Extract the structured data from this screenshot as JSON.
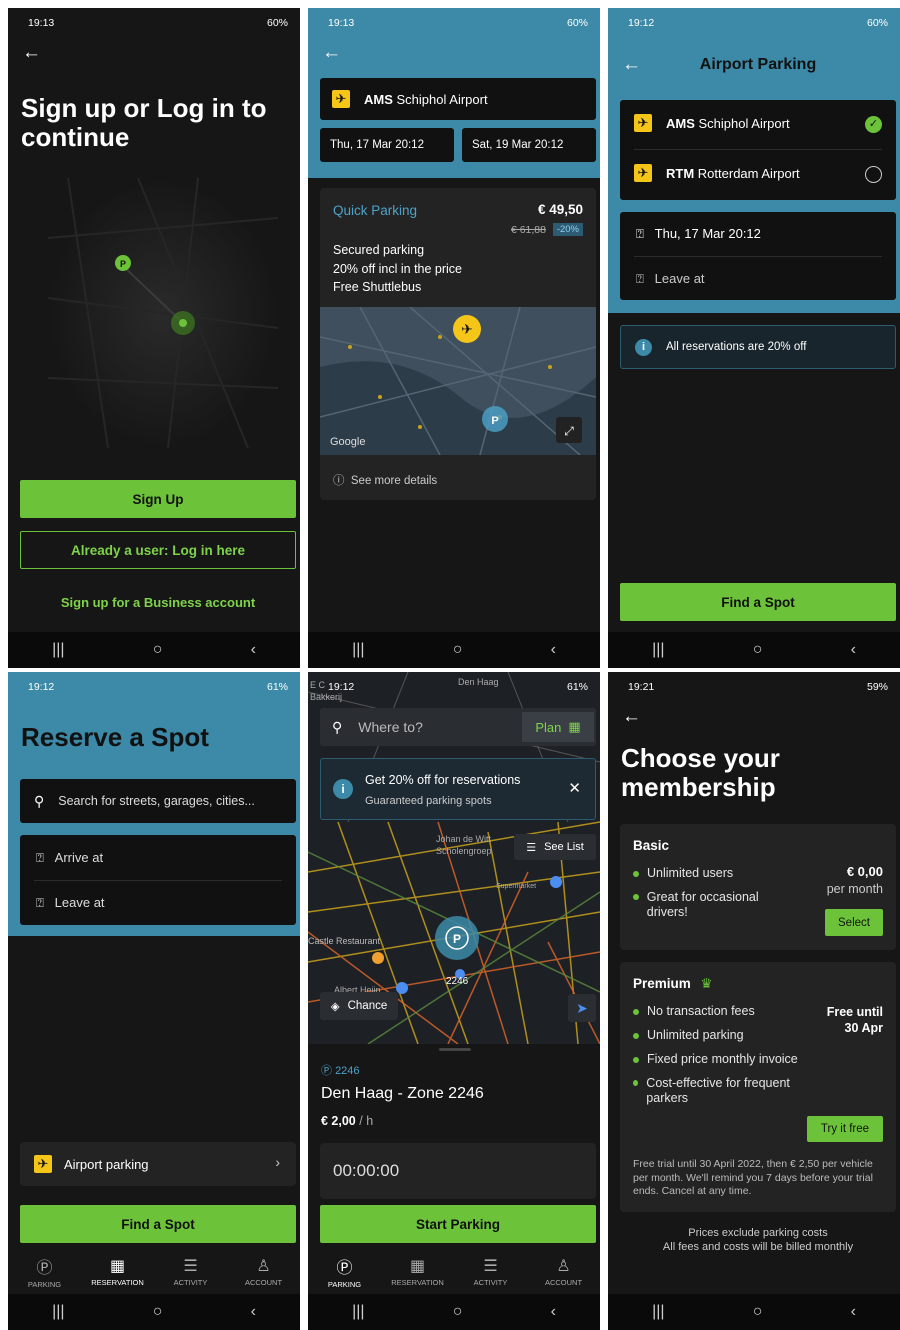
{
  "common": {
    "nav_icons": [
      "|||",
      "O",
      "<"
    ]
  },
  "s1": {
    "time": "19:13",
    "status_right": "60%",
    "title": "Sign up or Log in to continue",
    "signup": "Sign Up",
    "login": "Already a user: Log in here",
    "business": "Sign up for a Business account"
  },
  "s2": {
    "time": "19:13",
    "status_right": "60%",
    "airport_code": "AMS",
    "airport_name": "Schiphol Airport",
    "date_from": "Thu, 17 Mar 20:12",
    "date_to": "Sat, 19 Mar 20:12",
    "product": "Quick Parking",
    "price": "€ 49,50",
    "old_price": "€ 61,88",
    "discount": "-20%",
    "features": [
      "Secured parking",
      "20% off incl in the price",
      "Free Shuttlebus"
    ],
    "google": "Google",
    "details": "See more details"
  },
  "s3": {
    "time": "19:12",
    "status_right": "60%",
    "title": "Airport Parking",
    "airports": [
      {
        "code": "AMS",
        "name": "Schiphol Airport"
      },
      {
        "code": "RTM",
        "name": "Rotterdam Airport"
      }
    ],
    "arrive": "Thu, 17 Mar 20:12",
    "leave": "Leave at",
    "info": "All reservations are 20% off",
    "cta": "Find a Spot"
  },
  "s4": {
    "time": "19:12",
    "status_right": "61%",
    "title": "Reserve a Spot",
    "search_placeholder": "Search for streets, garages, cities...",
    "arrive": "Arrive at",
    "leave": "Leave at",
    "airport": "Airport parking",
    "cta": "Find a Spot"
  },
  "s5": {
    "time": "19:12",
    "status_right": "61%",
    "search_placeholder": "Where to?",
    "plan": "Plan",
    "promo_title": "Get 20% off for reservations",
    "promo_sub": "Guaranteed parking spots",
    "see_list": "See List",
    "chance": "Chance",
    "pin_label": "2246",
    "map_labels": [
      "Den Haag",
      "Johan de Witt Scholengroep",
      "Supermarket",
      "Castle Restaurant",
      "Albert Heijn",
      "E C",
      "Bakkerij"
    ],
    "zone_id": "2246",
    "zone_name": "Den Haag - Zone 2246",
    "rate": "€ 2,00",
    "rate_unit": "/ h",
    "timer": "00:00:00",
    "cta": "Start Parking"
  },
  "s6": {
    "time": "19:21",
    "status_right": "59%",
    "title": "Choose your membership",
    "basic": {
      "name": "Basic",
      "items": [
        "Unlimited users",
        "Great for occasional drivers!"
      ],
      "price": "€ 0,00",
      "price_unit": "per month",
      "btn": "Select"
    },
    "premium": {
      "name": "Premium",
      "items": [
        "No transaction fees",
        "Unlimited parking",
        "Fixed price monthly invoice",
        "Cost-effective for frequent parkers"
      ],
      "price": "Free until 30 Apr",
      "btn": "Try it free",
      "note": "Free trial until 30 April 2022, then € 2,50 per vehicle per month. We'll remind you 7 days before your trial ends. Cancel at any time."
    },
    "footer1": "Prices exclude parking costs",
    "footer2": "All fees and costs will be billed monthly"
  },
  "bottomnav": [
    "PARKING",
    "RESERVATION",
    "ACTIVITY",
    "ACCOUNT"
  ],
  "colors": {
    "accent": "#6cc33a",
    "teal": "#3c8aa8",
    "yellow": "#f5c518"
  }
}
